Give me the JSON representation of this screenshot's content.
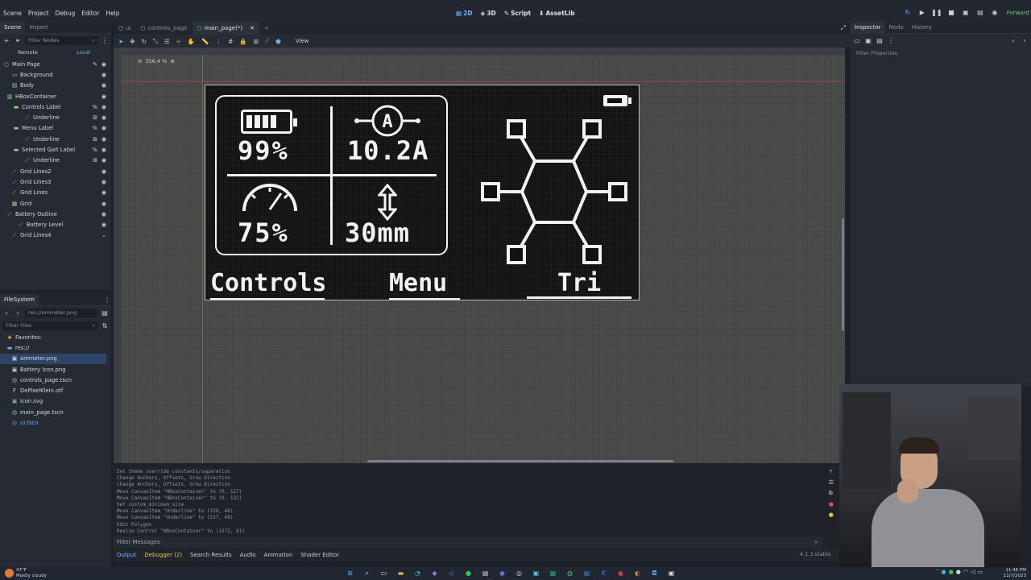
{
  "menubar": {
    "items": [
      "Scene",
      "Project",
      "Debug",
      "Editor",
      "Help"
    ],
    "workspaces": [
      {
        "label": "2D",
        "active": true
      },
      {
        "label": "3D",
        "active": false
      },
      {
        "label": "Script",
        "active": false
      },
      {
        "label": "AssetLib",
        "active": false
      }
    ],
    "renderer": "Forward"
  },
  "scene_dock": {
    "tabs": [
      "Scene",
      "Import"
    ],
    "filter_placeholder": "Filter Nodes",
    "remote_label": "Remote",
    "local_label": "Local",
    "tree": [
      {
        "label": "Main Page",
        "depth": 0,
        "icon": "control-node-icon"
      },
      {
        "label": "Background",
        "depth": 1,
        "icon": "panel-node-icon"
      },
      {
        "label": "Body",
        "depth": 1,
        "icon": "label-node-icon"
      },
      {
        "label": "HBoxContainer",
        "depth": 1,
        "icon": "hbox-node-icon"
      },
      {
        "label": "Controls Label",
        "depth": 2,
        "icon": "label-node-icon"
      },
      {
        "label": "Underline",
        "depth": 3,
        "icon": "line-node-icon"
      },
      {
        "label": "Menu Label",
        "depth": 2,
        "icon": "label-node-icon"
      },
      {
        "label": "Underline",
        "depth": 3,
        "icon": "line-node-icon"
      },
      {
        "label": "Selected Gait Label",
        "depth": 2,
        "icon": "label-node-icon"
      },
      {
        "label": "Underline",
        "depth": 3,
        "icon": "line-node-icon"
      },
      {
        "label": "Grid Lines2",
        "depth": 1,
        "icon": "line-node-icon"
      },
      {
        "label": "Grid Lines3",
        "depth": 1,
        "icon": "line-node-icon"
      },
      {
        "label": "Grid Lines",
        "depth": 1,
        "icon": "line-node-icon"
      },
      {
        "label": "Grid",
        "depth": 1,
        "icon": "grid-node-icon"
      },
      {
        "label": "Battery Outline",
        "depth": 1,
        "icon": "line-node-icon"
      },
      {
        "label": "Battery Level",
        "depth": 2,
        "icon": "line-node-icon"
      },
      {
        "label": "Grid Lines4",
        "depth": 1,
        "icon": "line-node-icon"
      }
    ]
  },
  "filesystem": {
    "title": "FileSystem",
    "path": "res://ammeter.png",
    "filter_placeholder": "Filter Files",
    "favorites_label": "Favorites:",
    "root_label": "res://",
    "files": [
      {
        "label": "ammeter.png",
        "selected": true
      },
      {
        "label": "Battery Icon.png",
        "selected": false
      },
      {
        "label": "controls_page.tscn",
        "selected": false
      },
      {
        "label": "DePixelKlein.otf",
        "selected": false
      },
      {
        "label": "icon.svg",
        "selected": false
      },
      {
        "label": "main_page.tscn",
        "selected": false
      },
      {
        "label": "ui.tscn",
        "selected": false
      }
    ]
  },
  "scene_tabs": [
    {
      "label": "ui",
      "active": false
    },
    {
      "label": "controls_page",
      "active": false
    },
    {
      "label": "main_page(*)",
      "active": true
    }
  ],
  "viewport": {
    "view_menu": "View",
    "zoom": "356.4 %"
  },
  "device_screen": {
    "battery_value": "99%",
    "current_value": "10.2A",
    "speed_value": "75%",
    "height_value": "30mm",
    "current_icon_letter": "A",
    "nav": [
      "Controls",
      "Menu",
      "Tri"
    ]
  },
  "output": {
    "lines": [
      "Set theme_override_constants/separation",
      "Change Anchors, Offsets, Grow Direction",
      "Change Anchors, Offsets, Grow Direction",
      "Move CanvasItem \"HBoxContainer\" to (0, 127)",
      "Move CanvasItem \"HBoxContainer\" to (0, 131)",
      "Set custom_minimum_size",
      "Move CanvasItem \"Underline\" to (329, 48)",
      "Move CanvasItem \"Underline\" to (317, 48)",
      "Edit Polygon",
      "Resize Control \"HBoxContainer\" to (1272, 81)"
    ],
    "filter_placeholder": "Filter Messages",
    "tabs": [
      "Output",
      "Debugger (2)",
      "Search Results",
      "Audio",
      "Animation",
      "Shader Editor"
    ],
    "version": "4.1.3.stable"
  },
  "inspector": {
    "tabs": [
      "Inspector",
      "Node",
      "History"
    ],
    "filter_placeholder": "Filter Properties"
  },
  "taskbar": {
    "weather_temp": "47°F",
    "weather_desc": "Mostly cloudy",
    "time": "11:46 PM",
    "date": "11/7/2023"
  }
}
